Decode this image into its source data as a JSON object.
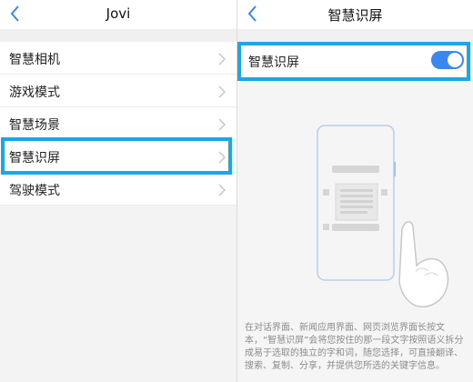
{
  "left_screen": {
    "title": "Jovi",
    "menu_items": [
      {
        "label": "智慧相机"
      },
      {
        "label": "游戏模式"
      },
      {
        "label": "智慧场景"
      },
      {
        "label": "智慧识屏"
      },
      {
        "label": "驾驶模式"
      }
    ],
    "highlighted_item": "智慧识屏"
  },
  "right_screen": {
    "title": "智慧识屏",
    "setting": {
      "label": "智慧识屏",
      "enabled": true
    },
    "description": "在对话界面、新闻应用界面、网页浏览界面长按文本，“智慧识屏”会将您按住的那一段文字按照语义拆分成易于选取的独立的字和词，随您选择，可直接翻译、搜索、复制、分享，并提供您所选的关键字信息。"
  },
  "colors": {
    "accent": "#1aa6e8",
    "toggle_on": "#3b87f0",
    "back_arrow": "#3b87f0"
  },
  "icons": {
    "back": "chevron-left-icon",
    "row_arrow": "chevron-right-icon"
  }
}
